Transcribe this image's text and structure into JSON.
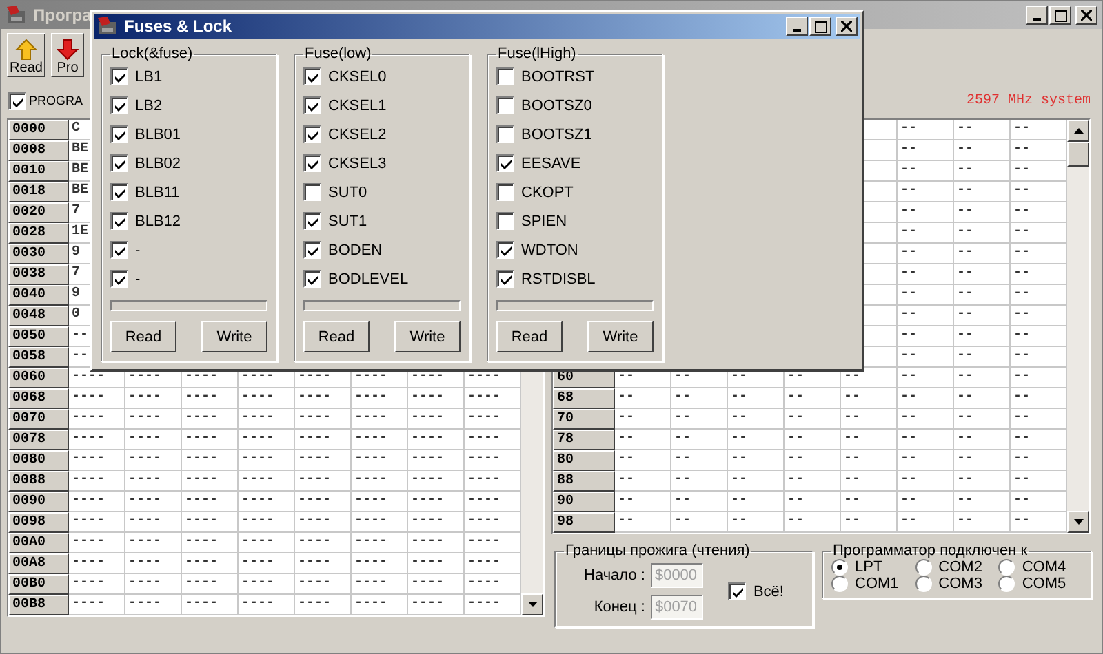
{
  "main_window": {
    "title": "Програ",
    "toolbar": [
      {
        "label": "Read"
      },
      {
        "label": "Pro"
      }
    ],
    "program_checkbox": {
      "label": "PROGRA",
      "checked": true
    },
    "cpu_info": "2597 MHz system",
    "left_table": {
      "rows": [
        {
          "address": "0000",
          "cells": [
            "C"
          ]
        },
        {
          "address": "0008",
          "cells": [
            "BE"
          ]
        },
        {
          "address": "0010",
          "cells": [
            "BE"
          ]
        },
        {
          "address": "0018",
          "cells": [
            "BE"
          ]
        },
        {
          "address": "0020",
          "cells": [
            "7"
          ]
        },
        {
          "address": "0028",
          "cells": [
            "1E"
          ]
        },
        {
          "address": "0030",
          "cells": [
            "9"
          ]
        },
        {
          "address": "0038",
          "cells": [
            "7"
          ]
        },
        {
          "address": "0040",
          "cells": [
            "9"
          ]
        },
        {
          "address": "0048",
          "cells": [
            "0"
          ]
        },
        {
          "address": "0050",
          "cells": [
            "--"
          ]
        },
        {
          "address": "0058",
          "cells": [
            "--"
          ]
        },
        {
          "address": "0060",
          "cells": [
            "----",
            "----",
            "----",
            "----",
            "----",
            "----",
            "----",
            "----"
          ]
        },
        {
          "address": "0068",
          "cells": [
            "----",
            "----",
            "----",
            "----",
            "----",
            "----",
            "----",
            "----"
          ]
        },
        {
          "address": "0070",
          "cells": [
            "----",
            "----",
            "----",
            "----",
            "----",
            "----",
            "----",
            "----"
          ]
        },
        {
          "address": "0078",
          "cells": [
            "----",
            "----",
            "----",
            "----",
            "----",
            "----",
            "----",
            "----"
          ]
        },
        {
          "address": "0080",
          "cells": [
            "----",
            "----",
            "----",
            "----",
            "----",
            "----",
            "----",
            "----"
          ]
        },
        {
          "address": "0088",
          "cells": [
            "----",
            "----",
            "----",
            "----",
            "----",
            "----",
            "----",
            "----"
          ]
        },
        {
          "address": "0090",
          "cells": [
            "----",
            "----",
            "----",
            "----",
            "----",
            "----",
            "----",
            "----"
          ]
        },
        {
          "address": "0098",
          "cells": [
            "----",
            "----",
            "----",
            "----",
            "----",
            "----",
            "----",
            "----"
          ]
        },
        {
          "address": "00A0",
          "cells": [
            "----",
            "----",
            "----",
            "----",
            "----",
            "----",
            "----",
            "----"
          ]
        },
        {
          "address": "00A8",
          "cells": [
            "----",
            "----",
            "----",
            "----",
            "----",
            "----",
            "----",
            "----"
          ]
        },
        {
          "address": "00B0",
          "cells": [
            "----",
            "----",
            "----",
            "----",
            "----",
            "----",
            "----",
            "----"
          ]
        },
        {
          "address": "00B8",
          "cells": [
            "----",
            "----",
            "----",
            "----",
            "----",
            "----",
            "----",
            "----"
          ]
        }
      ]
    },
    "right_table": {
      "rows": [
        {
          "cells": [
            "--",
            "--",
            "--"
          ]
        },
        {
          "cells": [
            "--",
            "--",
            "--"
          ]
        },
        {
          "cells": [
            "--",
            "--",
            "--"
          ]
        },
        {
          "cells": [
            "--",
            "--",
            "--"
          ]
        },
        {
          "cells": [
            "--",
            "--",
            "--"
          ]
        },
        {
          "cells": [
            "--",
            "--",
            "--"
          ]
        },
        {
          "cells": [
            "--",
            "--",
            "--"
          ]
        },
        {
          "cells": [
            "--",
            "--",
            "--"
          ]
        },
        {
          "cells": [
            "--",
            "--",
            "--"
          ]
        },
        {
          "cells": [
            "--",
            "--",
            "--"
          ]
        },
        {
          "cells": [
            "--",
            "--",
            "--"
          ]
        },
        {
          "cells": [
            "--",
            "--",
            "--"
          ]
        },
        {
          "address": "60",
          "cells": [
            "--",
            "--",
            "--",
            "--",
            "--",
            "--",
            "--",
            "--"
          ]
        },
        {
          "address": "68",
          "cells": [
            "--",
            "--",
            "--",
            "--",
            "--",
            "--",
            "--",
            "--"
          ]
        },
        {
          "address": "70",
          "cells": [
            "--",
            "--",
            "--",
            "--",
            "--",
            "--",
            "--",
            "--"
          ]
        },
        {
          "address": "78",
          "cells": [
            "--",
            "--",
            "--",
            "--",
            "--",
            "--",
            "--",
            "--"
          ]
        },
        {
          "address": "80",
          "cells": [
            "--",
            "--",
            "--",
            "--",
            "--",
            "--",
            "--",
            "--"
          ]
        },
        {
          "address": "88",
          "cells": [
            "--",
            "--",
            "--",
            "--",
            "--",
            "--",
            "--",
            "--"
          ]
        },
        {
          "address": "90",
          "cells": [
            "--",
            "--",
            "--",
            "--",
            "--",
            "--",
            "--",
            "--"
          ]
        },
        {
          "address": "98",
          "cells": [
            "--",
            "--",
            "--",
            "--",
            "--",
            "--",
            "--",
            "--"
          ]
        }
      ]
    },
    "burn_range": {
      "title": "Границы прожига (чтения)",
      "start_field": {
        "label": "Начало :",
        "value": "$0000",
        "disabled": true
      },
      "end_field": {
        "label": "Конец :",
        "value": "$0070",
        "disabled": true
      },
      "all_checkbox": {
        "label": "Всё!",
        "checked": true
      }
    },
    "port": {
      "title": "Программатор подключен к",
      "options": [
        {
          "label": "LPT",
          "selected": true
        },
        {
          "label": "COM2",
          "selected": false
        },
        {
          "label": "COM4",
          "selected": false
        },
        {
          "label": "COM1",
          "selected": false
        },
        {
          "label": "COM3",
          "selected": false
        },
        {
          "label": "COM5",
          "selected": false
        }
      ]
    }
  },
  "dialog": {
    "title": "Fuses & Lock",
    "groups": [
      {
        "title": "Lock(&fuse)",
        "bits": [
          {
            "label": "LB1",
            "checked": true
          },
          {
            "label": "LB2",
            "checked": true
          },
          {
            "label": "BLB01",
            "checked": true
          },
          {
            "label": "BLB02",
            "checked": true
          },
          {
            "label": "BLB11",
            "checked": true
          },
          {
            "label": "BLB12",
            "checked": true
          },
          {
            "label": "-",
            "checked": true
          },
          {
            "label": "-",
            "checked": true
          }
        ],
        "level": 0,
        "buttons": [
          "Read",
          "Write"
        ]
      },
      {
        "title": "Fuse(low)",
        "bits": [
          {
            "label": "CKSEL0",
            "checked": true
          },
          {
            "label": "CKSEL1",
            "checked": true
          },
          {
            "label": "CKSEL2",
            "checked": true
          },
          {
            "label": "CKSEL3",
            "checked": true
          },
          {
            "label": "SUT0",
            "checked": false
          },
          {
            "label": "SUT1",
            "checked": true
          },
          {
            "label": "BODEN",
            "checked": true
          },
          {
            "label": "BODLEVEL",
            "checked": true
          }
        ],
        "level": 0,
        "buttons": [
          "Read",
          "Write"
        ]
      },
      {
        "title": "Fuse(lHigh)",
        "bits": [
          {
            "label": "BOOTRST",
            "checked": false
          },
          {
            "label": "BOOTSZ0",
            "checked": false
          },
          {
            "label": "BOOTSZ1",
            "checked": false
          },
          {
            "label": "EESAVE",
            "checked": true
          },
          {
            "label": "CKOPT",
            "checked": false
          },
          {
            "label": "SPIEN",
            "checked": false
          },
          {
            "label": "WDTON",
            "checked": true
          },
          {
            "label": "RSTDISBL",
            "checked": true
          }
        ],
        "level": 0,
        "buttons": [
          "Read",
          "Write"
        ]
      }
    ]
  }
}
